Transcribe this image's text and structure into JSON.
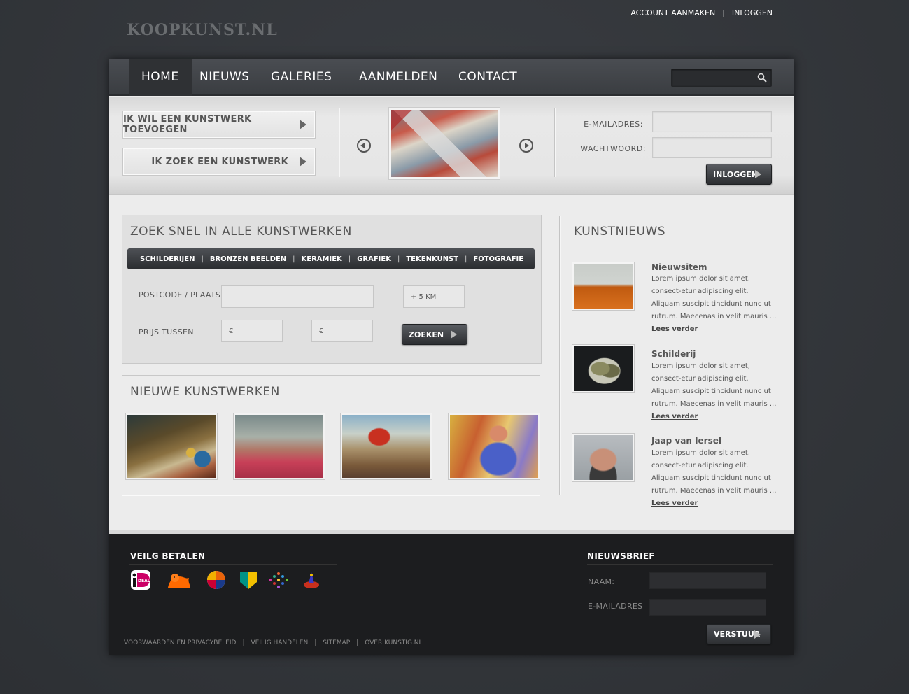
{
  "header": {
    "logo": "KOOPKUNST.NL",
    "links": [
      "ACCOUNT AANMAKEN",
      "INLOGGEN"
    ]
  },
  "nav": {
    "items": [
      "HOME",
      "NIEUWS",
      "GALERIES",
      "AANMELDEN",
      "CONTACT"
    ],
    "active": "HOME",
    "search_placeholder": ""
  },
  "hero": {
    "cta_add": "IK WIL EEN KUNSTWERK TOEVOEGEN",
    "cta_search": "IK ZOEK EEN KUNSTWERK",
    "login": {
      "email_label": "E-MAILADRES:",
      "password_label": "WACHTWOORD:",
      "button": "INLOGGEN"
    }
  },
  "search": {
    "title": "ZOEK SNEL IN ALLE KUNSTWERKEN",
    "categories": [
      "SCHILDERIJEN",
      "BRONZEN BEELDEN",
      "KERAMIEK",
      "GRAFIEK",
      "TEKENKUNST",
      "FOTOGRAFIE"
    ],
    "postcode_label": "POSTCODE / PLAATS",
    "distance_value": "+ 5 KM",
    "price_label": "PRIJS TUSSEN",
    "price_min": "€",
    "price_max": "€",
    "button": "ZOEKEN"
  },
  "new_works": {
    "title": "NIEUWE KUNSTWERKEN"
  },
  "news": {
    "title": "KUNSTNIEUWS",
    "items": [
      {
        "title": "Nieuwsitem",
        "text": "Lorem ipsum dolor sit amet, consect-etur adipiscing elit. Aliquam suscipit tincidunt nunc ut rutrum. Maecenas in velit mauris ...",
        "link": "Lees verder"
      },
      {
        "title": "Schilderij",
        "text": "Lorem ipsum dolor sit amet, consect-etur adipiscing elit. Aliquam suscipit tincidunt nunc ut rutrum. Maecenas in velit mauris ...",
        "link": "Lees verder"
      },
      {
        "title": "Jaap van Iersel",
        "text": "Lorem ipsum dolor sit amet, consect-etur adipiscing elit. Aliquam suscipit tincidunt nunc ut rutrum. Maecenas in velit mauris ...",
        "link": "Lees verder"
      }
    ]
  },
  "footer": {
    "payment_title": "VEILG BETALEN",
    "payment_icons": [
      "ideal-icon",
      "ing-lion-icon",
      "rabobank-icon",
      "abn-amro-icon",
      "mastercard-dots-icon",
      "fortis-icon"
    ],
    "newsletter_title": "NIEUWSBRIEF",
    "name_label": "NAAM:",
    "email_label": "E-MAILADRES",
    "send_button": "VERSTUUR",
    "links": [
      "VOORWAARDEN EN PRIVACYBELEID",
      "VEILIG HANDELEN",
      "SITEMAP",
      "OVER KUNSTIG.NL"
    ]
  }
}
